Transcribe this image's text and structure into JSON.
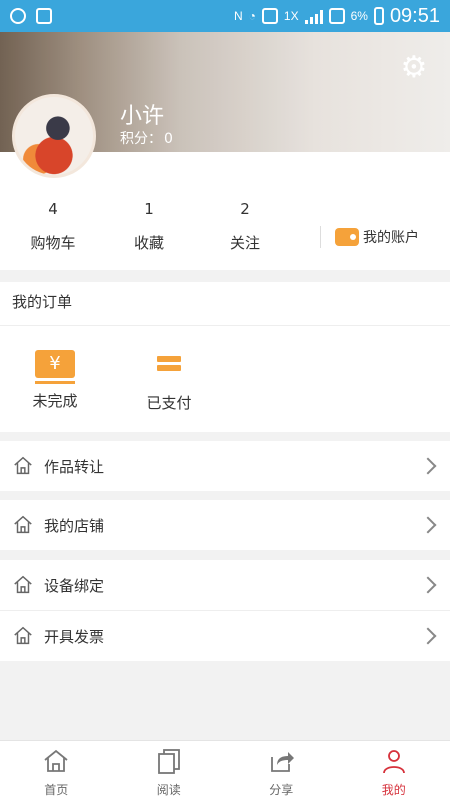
{
  "status_bar": {
    "time": "09:51",
    "battery": "6%",
    "net_label": "1X"
  },
  "profile": {
    "name": "小许",
    "points_label": "积分：",
    "points_value": "0"
  },
  "stats": [
    {
      "num": "4",
      "label": "购物车"
    },
    {
      "num": "1",
      "label": "收藏"
    },
    {
      "num": "2",
      "label": "关注"
    }
  ],
  "account": {
    "label": "我的账户"
  },
  "orders": {
    "title": "我的订单",
    "items": [
      {
        "label": "未完成"
      },
      {
        "label": "已支付"
      }
    ],
    "yen": "¥"
  },
  "menu": [
    {
      "label": "作品转让"
    },
    {
      "label": "我的店铺"
    },
    {
      "label": "设备绑定"
    },
    {
      "label": "开具发票"
    }
  ],
  "tabs": [
    {
      "label": "首页",
      "icon": "home-icon"
    },
    {
      "label": "阅读",
      "icon": "pages-icon"
    },
    {
      "label": "分享",
      "icon": "share-icon"
    },
    {
      "label": "我的",
      "icon": "user-icon",
      "active": true
    }
  ],
  "colors": {
    "status_bar": "#3aa6dc",
    "accent_orange": "#f5a23a",
    "active_red": "#d6313b"
  }
}
